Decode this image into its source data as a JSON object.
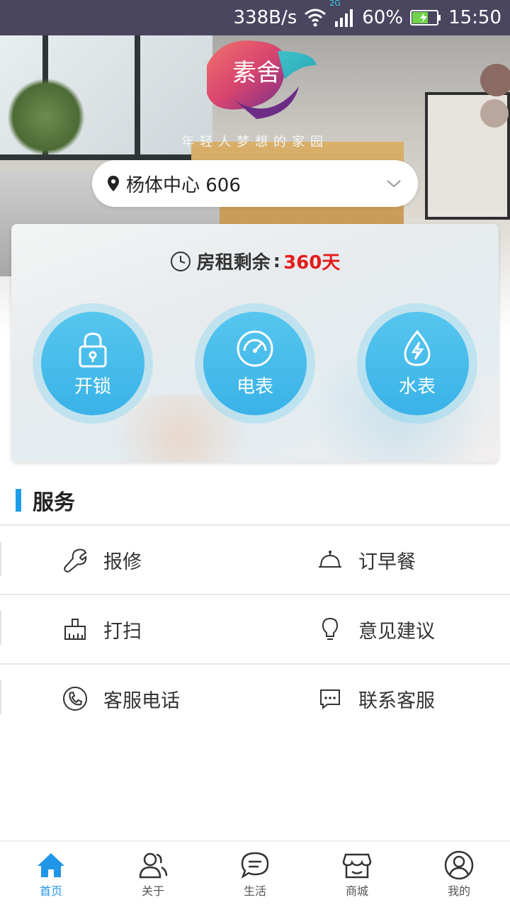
{
  "status_bar": {
    "speed": "338B/s",
    "battery": "60%",
    "time": "15:50",
    "network": "2G"
  },
  "hero": {
    "logo_text": "素舍",
    "tagline": "年轻人梦想的家园"
  },
  "location": {
    "text": "杨体中心 606"
  },
  "rent": {
    "label": "房租剩余",
    "separator": ":",
    "value": "360天"
  },
  "actions": [
    {
      "label": "开锁",
      "icon": "lock-icon"
    },
    {
      "label": "电表",
      "icon": "meter-icon"
    },
    {
      "label": "水表",
      "icon": "water-icon"
    }
  ],
  "services": {
    "title": "服务",
    "items": [
      {
        "label": "报修",
        "icon": "wrench-icon"
      },
      {
        "label": "订早餐",
        "icon": "food-cover-icon"
      },
      {
        "label": "打扫",
        "icon": "broom-icon"
      },
      {
        "label": "意见建议",
        "icon": "bulb-icon"
      },
      {
        "label": "客服电话",
        "icon": "phone-icon"
      },
      {
        "label": "联系客服",
        "icon": "chat-icon"
      }
    ]
  },
  "tabs": [
    {
      "label": "首页",
      "icon": "home-icon",
      "active": true
    },
    {
      "label": "关于",
      "icon": "people-icon",
      "active": false
    },
    {
      "label": "生活",
      "icon": "chat-bubble-icon",
      "active": false
    },
    {
      "label": "商城",
      "icon": "store-icon",
      "active": false
    },
    {
      "label": "我的",
      "icon": "user-icon",
      "active": false
    }
  ],
  "colors": {
    "accent": "#2196e8",
    "rent_value": "#e41b1b",
    "action_blue": "#3ab2e8"
  }
}
